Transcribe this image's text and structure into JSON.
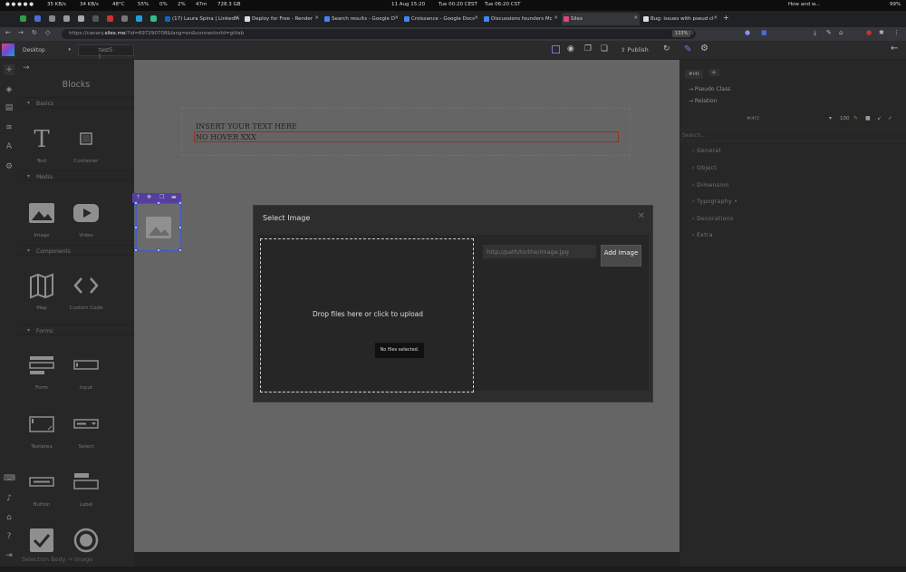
{
  "os_bar": {
    "net_up": "35 KB/s",
    "net_down": "34 KB/s",
    "temp": "48°C",
    "mem": "55%",
    "cpu": "0%",
    "cpu2": "2%",
    "uptime": "47m",
    "disk": "728.3 GB",
    "date": "11 Aug  15:20",
    "tz1": "Tue 00:20 CEST",
    "tz2": "Tue 06:20 CST",
    "notif": "How and w...",
    "battery": "99%"
  },
  "browser": {
    "tabs": [
      {
        "label": "(17) Laura Spina | LinkedIn"
      },
      {
        "label": "Deploy for Free - Render"
      },
      {
        "label": "Search results - Google D"
      },
      {
        "label": "Croissance - Google Docs"
      },
      {
        "label": "Discussions founders Mc"
      },
      {
        "label": "Silex"
      },
      {
        "label": "Bug: issues with pseud cl"
      }
    ],
    "new_tab": "+",
    "url_prefix": "https://canary.",
    "url_host": "silex.me",
    "url_rest": "/?id=697290708&lang=en&connectorId=gitlab",
    "zoom": "133%"
  },
  "silex": {
    "device": "Desktop",
    "page_name": "test5 |",
    "publish_label": "Publish"
  },
  "blocks_panel": {
    "title": "Blocks",
    "sections": {
      "basics": "Basics",
      "media": "Media",
      "components": "Components",
      "forms": "Forms"
    },
    "items": {
      "text": "Text",
      "container": "Container",
      "image": "Image",
      "video": "Video",
      "map": "Map",
      "custom_code": "Custom Code",
      "form": "Form",
      "input": "Input",
      "textarea": "Textarea",
      "select": "Select",
      "button": "Button",
      "label": "Label"
    }
  },
  "canvas": {
    "text1": "INSERT YOUR TEXT HERE",
    "text2": "NO HOVER XXX"
  },
  "right_panel": {
    "selector_tag": "#i4t",
    "add": "+",
    "pseudo_class": "→ Pseudo Class",
    "relation": "→ Relation",
    "element_id": "#i4t3",
    "opacity": "100",
    "search_placeholder": "Search...",
    "sections": [
      "General",
      "Object",
      "Dimension",
      "Typography •",
      "Decorations",
      "Extra"
    ]
  },
  "modal": {
    "title": "Select Image",
    "drop_text": "Drop files here or click to upload",
    "no_files": "No files selected.",
    "url_placeholder": "http://path/to/the/image.jpg",
    "add_button": "Add image"
  },
  "bottom_bar": {
    "text": "Selection  Body  →  Image"
  }
}
